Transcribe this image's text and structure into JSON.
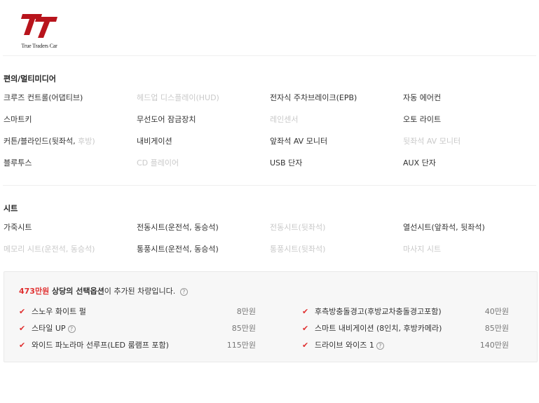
{
  "brand": {
    "logo_text": "True Traders Car"
  },
  "sections": {
    "convenience": {
      "title": "편의/멀티미디어",
      "rows": [
        [
          {
            "label": "크루즈 컨트롤(어댑티브)",
            "on": true
          },
          {
            "label": "헤드업 디스플레이(HUD)",
            "on": false
          },
          {
            "label": "전자식 주차브레이크(EPB)",
            "on": true
          },
          {
            "label": "자동 에어컨",
            "on": true
          }
        ],
        [
          {
            "label": "스마트키",
            "on": true
          },
          {
            "label": "무선도어 잠금장치",
            "on": true
          },
          {
            "label": "레인센서",
            "on": false
          },
          {
            "label": "오토 라이트",
            "on": true
          }
        ],
        [
          {
            "label": "커튼/블라인드(뒷좌석, ",
            "sub": "후방)",
            "on": true
          },
          {
            "label": "내비게이션",
            "on": true
          },
          {
            "label": "앞좌석 AV 모니터",
            "on": true
          },
          {
            "label": "뒷좌석 AV 모니터",
            "on": false
          }
        ],
        [
          {
            "label": "블루투스",
            "on": true
          },
          {
            "label": "CD 플레이어",
            "on": false
          },
          {
            "label": "USB 단자",
            "on": true
          },
          {
            "label": "AUX 단자",
            "on": true
          }
        ]
      ]
    },
    "seats": {
      "title": "시트",
      "rows": [
        [
          {
            "label": "가죽시트",
            "on": true
          },
          {
            "label": "전동시트(운전석, 동승석)",
            "on": true
          },
          {
            "label": "전동시트(뒷좌석)",
            "on": false
          },
          {
            "label": "열선시트(앞좌석, 뒷좌석)",
            "on": true
          }
        ],
        [
          {
            "label": "메모리 시트(운전석, 동승석)",
            "on": false
          },
          {
            "label": "통풍시트(운전석, 동승석)",
            "on": true
          },
          {
            "label": "통풍시트(뒷좌석)",
            "on": false
          },
          {
            "label": "마사지 시트",
            "on": false
          }
        ]
      ]
    }
  },
  "options_box": {
    "price": "473만원",
    "head_bold": " 상당의 선택옵션",
    "head_rest": "이 추가된 차량입니다.",
    "help_icon": "?",
    "left": [
      {
        "name": "스노우 화이트 펄",
        "price": "8만원",
        "help": false
      },
      {
        "name": "스타일 UP",
        "price": "85만원",
        "help": true
      },
      {
        "name": "와이드 파노라마 선루프(LED 룸램프 포함)",
        "price": "115만원",
        "help": false
      }
    ],
    "right": [
      {
        "name": "후측방충돌경고(후방교차충돌경고포함)",
        "price": "40만원",
        "help": false
      },
      {
        "name": "스마트 내비게이션 (8인치, 후방카메라)",
        "price": "85만원",
        "help": false
      },
      {
        "name": "드라이브 와이즈 1",
        "price": "140만원",
        "help": true
      }
    ],
    "check_icon": "✔"
  },
  "colors": {
    "accent": "#e03131",
    "muted": "#c9c9c9",
    "logo_red": "#b8141c"
  }
}
